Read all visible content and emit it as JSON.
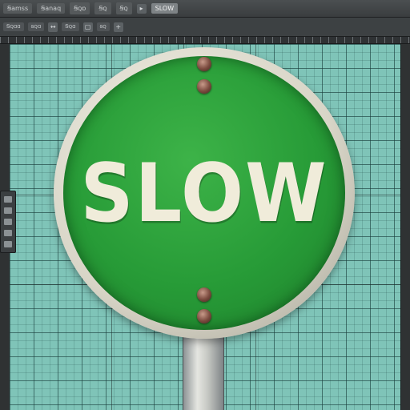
{
  "app": {
    "menu": [
      "Ꞩamss",
      "Ꞩanaq",
      "Ꞩꞯɒ",
      "Ꞩꞯ",
      "Ꞩꞯ"
    ],
    "active_tab": "SLOW",
    "toolbar": [
      "Ꞩꞯɑɑ",
      "ꞩꞯɑ",
      "Ꞩꞯɑ",
      "ꞩꞯ"
    ]
  },
  "canvas": {
    "background_color": "#7fc4b8",
    "grid_color": "#183c3a"
  },
  "sign": {
    "text": "SLOW",
    "face_color": "#279b37",
    "text_color": "#f0ecda",
    "rim_color": "#d8d5c7"
  },
  "icons": {
    "toolbar_icon_1": "arrow-icon",
    "toolbar_icon_2": "square-icon",
    "toolbar_icon_3": "plus-icon"
  }
}
